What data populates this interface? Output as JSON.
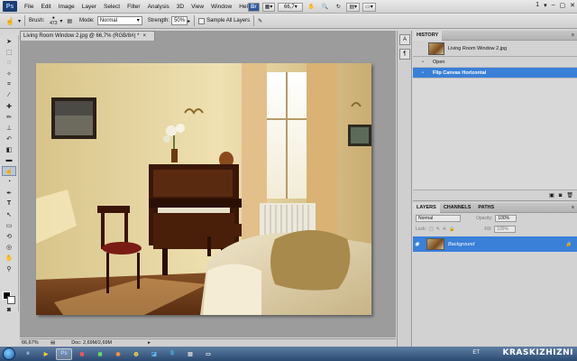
{
  "app": {
    "logo": "Ps"
  },
  "menu": [
    "File",
    "Edit",
    "Image",
    "Layer",
    "Select",
    "Filter",
    "Analysis",
    "3D",
    "View",
    "Window",
    "Help"
  ],
  "menubar_right": {
    "zoom": "66,7",
    "workspace": "1"
  },
  "options": {
    "brush_label": "Brush:",
    "brush_size": "473",
    "mode_label": "Mode:",
    "mode_value": "Normal",
    "strength_label": "Strength:",
    "strength_value": "50%",
    "sample_all_label": "Sample All Layers"
  },
  "document": {
    "tab_title": "Living Room Window 2.jpg @ 66,7% (RGB/8#) *",
    "tab_close": "×",
    "zoom": "66,67%",
    "doc_info": "Doc: 2,69M/2,69M"
  },
  "history": {
    "tab": "HISTORY",
    "snapshot": "Living Room Window 2.jpg",
    "items": [
      {
        "label": "Open",
        "active": false
      },
      {
        "label": "Flip Canvas Horizontal",
        "active": true
      }
    ]
  },
  "layers": {
    "tabs": [
      "LAYERS",
      "CHANNELS",
      "PATHS"
    ],
    "blend_mode": "Normal",
    "opacity_label": "Opacity:",
    "opacity_value": "100%",
    "lock_label": "Lock:",
    "fill_label": "Fill:",
    "fill_value": "100%",
    "items": [
      {
        "name": "Background",
        "active": true
      }
    ]
  },
  "taskbar": {
    "lang": "ET",
    "watermark": "KRASKIZHIZNI"
  },
  "colors": {
    "accent": "#3a7fd8",
    "taskbar": "#2b4a72"
  }
}
